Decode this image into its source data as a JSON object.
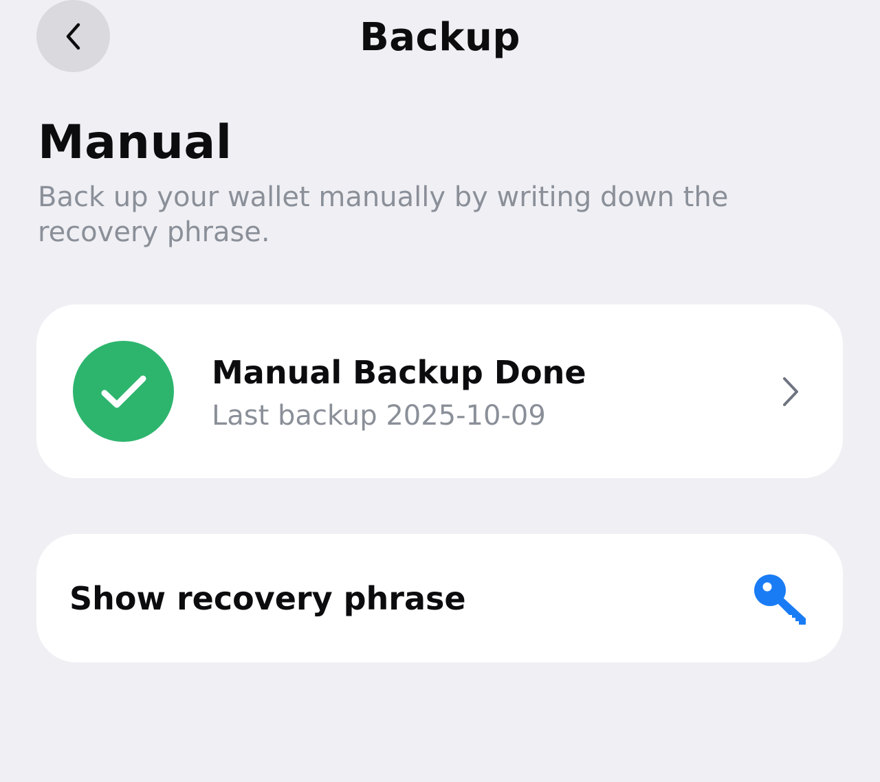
{
  "header": {
    "title": "Backup",
    "back_icon": "chevron-left-icon"
  },
  "section": {
    "title": "Manual",
    "description": "Back up your wallet manually by writing down the recovery phrase."
  },
  "backup_status_card": {
    "title": "Manual Backup Done",
    "subtitle": "Last backup 2025-10-09",
    "status_icon": "checkmark-icon",
    "status_color": "#2db56e",
    "chevron_icon": "chevron-right-icon"
  },
  "recovery_card": {
    "label": "Show recovery phrase",
    "icon": "key-icon",
    "icon_color": "#1a7cf5"
  },
  "colors": {
    "background": "#efeff4",
    "card": "#ffffff",
    "secondary_text": "#8a8f98"
  }
}
